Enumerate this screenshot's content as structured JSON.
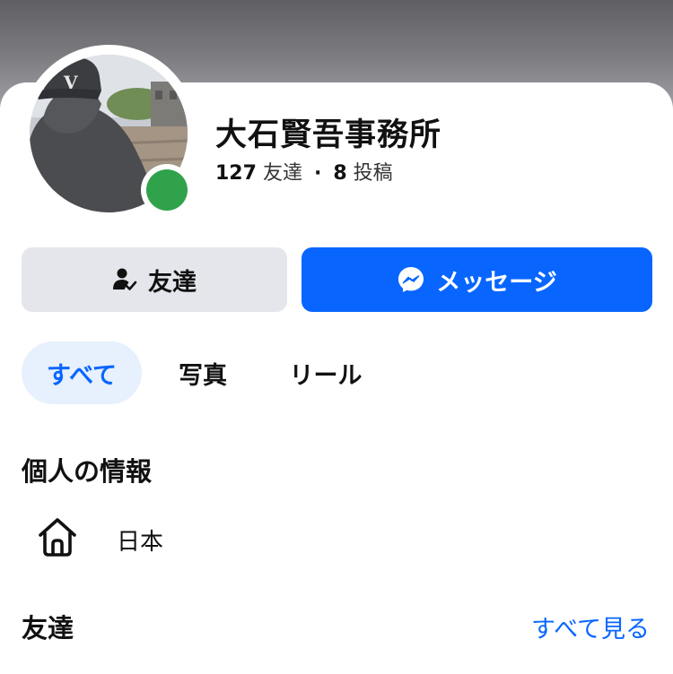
{
  "colors": {
    "accent": "#0866ff",
    "online": "#31a24c",
    "tab_active_bg": "#e7f0fd",
    "button_secondary_bg": "#e4e6eb"
  },
  "profile": {
    "name": "大石賢吾事務所",
    "friend_count": "127",
    "friends_label": "友達",
    "separator": "·",
    "post_count": "8",
    "posts_label": "投稿",
    "online": true
  },
  "actions": {
    "friends_button": {
      "label": "友達",
      "icon": "friend-check-icon"
    },
    "message_button": {
      "label": "メッセージ",
      "icon": "messenger-icon"
    }
  },
  "tabs": [
    {
      "label": "すべて",
      "active": true
    },
    {
      "label": "写真",
      "active": false
    },
    {
      "label": "リール",
      "active": false
    }
  ],
  "personal_info": {
    "title": "個人の情報",
    "items": [
      {
        "icon": "home-icon",
        "text": "日本"
      }
    ]
  },
  "friends_section": {
    "title": "友達",
    "see_all": "すべて見る"
  }
}
